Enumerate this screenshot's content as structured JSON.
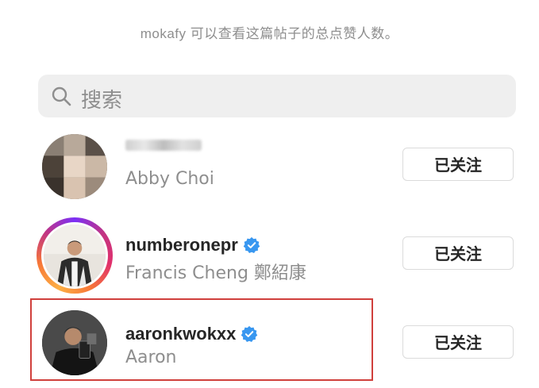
{
  "header": {
    "notice": "mokafy 可以查看这篇帖子的总点赞人数。"
  },
  "search": {
    "placeholder": "搜索",
    "icon": "search-icon"
  },
  "users": [
    {
      "username": "",
      "username_blurred": true,
      "full_name": "Abby Choi",
      "verified": false,
      "follow_label": "已关注",
      "has_story_ring": false
    },
    {
      "username": "numberonepr",
      "username_blurred": false,
      "full_name": "Francis Cheng 鄭紹康",
      "verified": true,
      "follow_label": "已关注",
      "has_story_ring": true
    },
    {
      "username": "aaronkwokxx",
      "username_blurred": false,
      "full_name": "Aaron",
      "verified": true,
      "follow_label": "已关注",
      "has_story_ring": false
    }
  ],
  "colors": {
    "verified_badge": "#3897f0",
    "highlight_border": "#d0403c",
    "secondary_text": "#8e8e8e"
  }
}
